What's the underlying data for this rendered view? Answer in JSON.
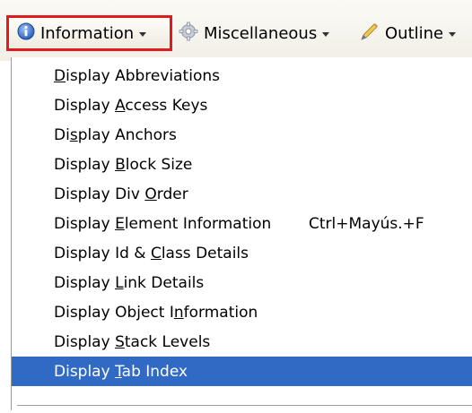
{
  "toolbar": {
    "information_label": "Information",
    "miscellaneous_label": "Miscellaneous",
    "outline_label": "Outline",
    "icons": {
      "information": "info-circle-icon",
      "miscellaneous": "gear-icon",
      "outline": "pencil-icon"
    },
    "highlight_color": "#e01a1e"
  },
  "menu": {
    "selected_color": "#316ac5",
    "items": [
      {
        "label": "Display Abbreviations",
        "pre": "",
        "key": "D",
        "post": "isplay Abbreviations",
        "shortcut": ""
      },
      {
        "label": "Display Access Keys",
        "pre": "Display ",
        "key": "A",
        "post": "ccess Keys",
        "shortcut": ""
      },
      {
        "label": "Display Anchors",
        "pre": "Di",
        "key": "s",
        "post": "play Anchors",
        "shortcut": ""
      },
      {
        "label": "Display Block Size",
        "pre": "Display ",
        "key": "B",
        "post": "lock Size",
        "shortcut": ""
      },
      {
        "label": "Display Div Order",
        "pre": "Display Div ",
        "key": "O",
        "post": "rder",
        "shortcut": ""
      },
      {
        "label": "Display Element Information",
        "pre": "Display ",
        "key": "E",
        "post": "lement Information",
        "shortcut": "Ctrl+Mayús.+F"
      },
      {
        "label": "Display Id & Class Details",
        "pre": "Display Id & ",
        "key": "C",
        "post": "lass Details",
        "shortcut": ""
      },
      {
        "label": "Display Link Details",
        "pre": "Display ",
        "key": "L",
        "post": "ink Details",
        "shortcut": ""
      },
      {
        "label": "Display Object Information",
        "pre": "Display Object I",
        "key": "n",
        "post": "formation",
        "shortcut": ""
      },
      {
        "label": "Display Stack Levels",
        "pre": "Display ",
        "key": "S",
        "post": "tack Levels",
        "shortcut": ""
      },
      {
        "label": "Display Tab Index",
        "pre": "Display ",
        "key": "T",
        "post": "ab Index",
        "shortcut": "",
        "selected": true
      }
    ]
  }
}
